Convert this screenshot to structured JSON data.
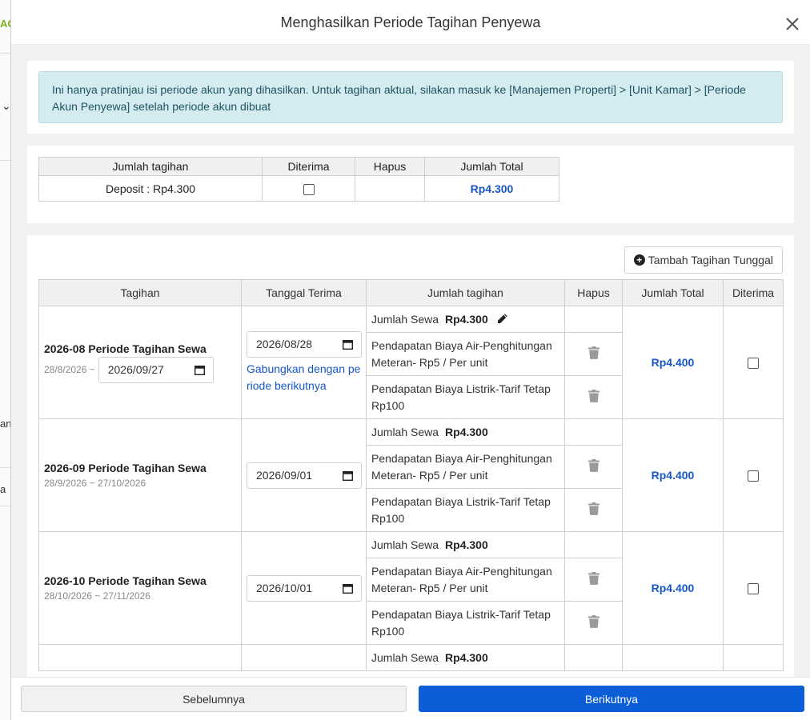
{
  "background": {
    "fragments": [
      "AG",
      "an",
      "a"
    ]
  },
  "modal": {
    "title": "Menghasilkan Periode Tagihan Penyewa",
    "info": "Ini hanya pratinjau isi periode akun yang dihasilkan. Untuk tagihan aktual, silakan masuk ke [Manajemen Properti] > [Unit Kamar] > [Periode Akun Penyewa] setelah periode akun dibuat"
  },
  "deposit_table": {
    "headers": [
      "Jumlah tagihan",
      "Diterima",
      "Hapus",
      "Jumlah Total"
    ],
    "row": {
      "amount": "Deposit : Rp4.300",
      "total": "Rp4.300"
    }
  },
  "add_single_bill_label": "Tambah Tagihan Tunggal",
  "period_table": {
    "headers": [
      "Tagihan",
      "Tanggal Terima",
      "Jumlah tagihan",
      "Hapus",
      "Jumlah Total",
      "Diterima"
    ],
    "merge_label": "Gabungkan dengan periode berikutnya",
    "periods": [
      {
        "name": "2026-08 Periode Tagihan Sewa",
        "range_start": "28/8/2026 ~",
        "range_end_input": "2026/09/27",
        "receive_date": "2026/08/28",
        "rent_label": "Jumlah Sewa",
        "rent_amount": "Rp4.300",
        "water": "Pendapatan Biaya Air-Penghitungan Meteran- Rp5 / Per unit",
        "electric": "Pendapatan Biaya Listrik-Tarif Tetap Rp100",
        "total": "Rp4.400"
      },
      {
        "name": "2026-09 Periode Tagihan Sewa",
        "range": "28/9/2026 ~ 27/10/2026",
        "receive_date": "2026/09/01",
        "rent_label": "Jumlah Sewa",
        "rent_amount": "Rp4.300",
        "water": "Pendapatan Biaya Air-Penghitungan Meteran- Rp5 / Per unit",
        "electric": "Pendapatan Biaya Listrik-Tarif Tetap Rp100",
        "total": "Rp4.400"
      },
      {
        "name": "2026-10 Periode Tagihan Sewa",
        "range": "28/10/2026 ~ 27/11/2026",
        "receive_date": "2026/10/01",
        "rent_label": "Jumlah Sewa",
        "rent_amount": "Rp4.300",
        "water": "Pendapatan Biaya Air-Penghitungan Meteran- Rp5 / Per unit",
        "electric": "Pendapatan Biaya Listrik-Tarif Tetap Rp100",
        "total": "Rp4.400"
      },
      {
        "rent_label": "Jumlah Sewa",
        "rent_amount": "Rp4.300"
      }
    ]
  },
  "footer": {
    "prev_label": "Sebelumnya",
    "next_label": "Berikutnya"
  },
  "colors": {
    "primary": "#0b5ed7",
    "link": "#1757c8",
    "alert_bg": "#d4ecf0"
  }
}
